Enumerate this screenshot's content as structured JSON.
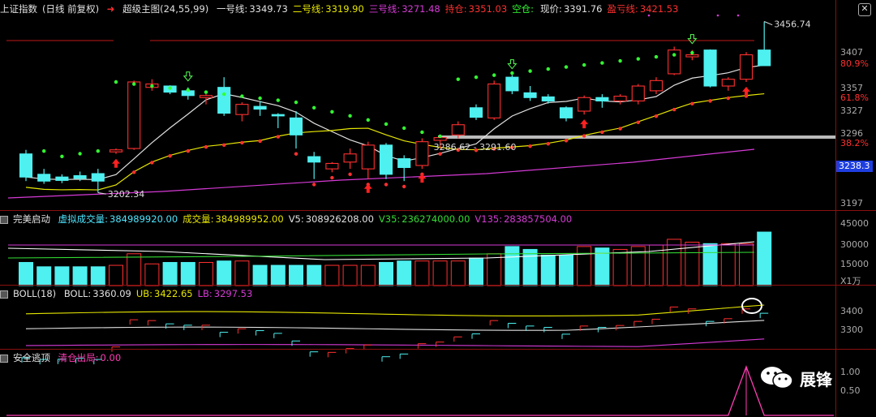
{
  "main": {
    "title": "上证指数",
    "period": "(日线 前复权)",
    "indicator_name": "超级主图",
    "indicator_params": "(24,55,99)",
    "items": [
      {
        "label": "一号线:",
        "value": "3349.73",
        "color": "#e0e0e0"
      },
      {
        "label": "二号线:",
        "value": "3319.90",
        "color": "#e6e600"
      },
      {
        "label": "三号线:",
        "value": "3271.48",
        "color": "#d63ad6"
      },
      {
        "label": "持仓:",
        "value": "3351.03",
        "color": "#ff3030"
      },
      {
        "label": "空仓:",
        "value": "",
        "color": "#33ff33"
      },
      {
        "label": "现价:",
        "value": "3391.76",
        "color": "#e0e0e0"
      },
      {
        "label": "盈亏线:",
        "value": "3421.53",
        "color": "#ff3030"
      }
    ],
    "high_label": "3456.74",
    "low_label": "3202.34",
    "range_label": "3286.62 - 3291.60",
    "y_labels": [
      "3407",
      "80.9%",
      "3357",
      "61.8%",
      "3327",
      "3296",
      "38.2%",
      "3197"
    ],
    "current_tag": "3238.3"
  },
  "volume": {
    "title": "完美启动",
    "items": [
      {
        "label": "虚拟成交量:",
        "value": "384989920.00",
        "color": "#4de6ff"
      },
      {
        "label": "成交量:",
        "value": "384989952.00",
        "color": "#e6e600"
      },
      {
        "label": "V5:",
        "value": "308926208.00",
        "color": "#e0e0e0"
      },
      {
        "label": "V35:",
        "value": "236274000.00",
        "color": "#33dd33"
      },
      {
        "label": "V135:",
        "value": "283857504.00",
        "color": "#d63ad6"
      }
    ],
    "y_labels": [
      "45000",
      "30000",
      "15000",
      "X1万"
    ]
  },
  "boll": {
    "title": "BOLL(18)",
    "items": [
      {
        "label": "BOLL:",
        "value": "3360.09",
        "color": "#e0e0e0"
      },
      {
        "label": "UB:",
        "value": "3422.65",
        "color": "#e6e600"
      },
      {
        "label": "LB:",
        "value": "3297.53",
        "color": "#d63ad6"
      }
    ],
    "y_labels": [
      "3400",
      "3300"
    ]
  },
  "safe": {
    "title": "安全逃顶",
    "items": [
      {
        "label": "清仓出局:",
        "value": "0.00",
        "color": "#ff3cb4"
      }
    ],
    "y_labels": [
      "1.00",
      "0.50"
    ]
  },
  "watermark": "展锋",
  "colors": {
    "up": "#ff3030",
    "down": "#4ef0f0",
    "ma_white": "#e0e0e0",
    "ma_yellow": "#e6e600",
    "ma_purple": "#d63ad6"
  },
  "chart_data": {
    "type": "candlestick",
    "price_range": [
      3190,
      3460
    ],
    "candles": [
      {
        "o": 3262,
        "h": 3268,
        "l": 3222,
        "c": 3228
      },
      {
        "o": 3232,
        "h": 3240,
        "l": 3218,
        "c": 3222
      },
      {
        "o": 3228,
        "h": 3232,
        "l": 3219,
        "c": 3223
      },
      {
        "o": 3230,
        "h": 3236,
        "l": 3222,
        "c": 3226
      },
      {
        "o": 3233,
        "h": 3240,
        "l": 3205,
        "c": 3222
      },
      {
        "o": 3265,
        "h": 3270,
        "l": 3262,
        "c": 3268
      },
      {
        "o": 3270,
        "h": 3370,
        "l": 3268,
        "c": 3368
      },
      {
        "o": 3360,
        "h": 3372,
        "l": 3355,
        "c": 3365
      },
      {
        "o": 3362,
        "h": 3363,
        "l": 3350,
        "c": 3353
      },
      {
        "o": 3355,
        "h": 3360,
        "l": 3342,
        "c": 3348
      },
      {
        "o": 3345,
        "h": 3350,
        "l": 3335,
        "c": 3348
      },
      {
        "o": 3360,
        "h": 3375,
        "l": 3318,
        "c": 3322
      },
      {
        "o": 3320,
        "h": 3338,
        "l": 3310,
        "c": 3335
      },
      {
        "o": 3332,
        "h": 3340,
        "l": 3318,
        "c": 3328
      },
      {
        "o": 3320,
        "h": 3322,
        "l": 3300,
        "c": 3318
      },
      {
        "o": 3315,
        "h": 3325,
        "l": 3270,
        "c": 3290
      },
      {
        "o": 3258,
        "h": 3265,
        "l": 3225,
        "c": 3250
      },
      {
        "o": 3240,
        "h": 3250,
        "l": 3235,
        "c": 3248
      },
      {
        "o": 3250,
        "h": 3270,
        "l": 3240,
        "c": 3262
      },
      {
        "o": 3240,
        "h": 3280,
        "l": 3225,
        "c": 3275
      },
      {
        "o": 3275,
        "h": 3278,
        "l": 3225,
        "c": 3232
      },
      {
        "o": 3255,
        "h": 3260,
        "l": 3222,
        "c": 3242
      },
      {
        "o": 3245,
        "h": 3285,
        "l": 3240,
        "c": 3280
      },
      {
        "o": 3282,
        "h": 3290,
        "l": 3270,
        "c": 3286
      },
      {
        "o": 3290,
        "h": 3310,
        "l": 3285,
        "c": 3305
      },
      {
        "o": 3330,
        "h": 3335,
        "l": 3312,
        "c": 3316
      },
      {
        "o": 3315,
        "h": 3370,
        "l": 3312,
        "c": 3365
      },
      {
        "o": 3375,
        "h": 3378,
        "l": 3350,
        "c": 3355
      },
      {
        "o": 3352,
        "h": 3362,
        "l": 3340,
        "c": 3345
      },
      {
        "o": 3346,
        "h": 3350,
        "l": 3336,
        "c": 3340
      },
      {
        "o": 3330,
        "h": 3332,
        "l": 3310,
        "c": 3315
      },
      {
        "o": 3325,
        "h": 3348,
        "l": 3320,
        "c": 3345
      },
      {
        "o": 3345,
        "h": 3350,
        "l": 3330,
        "c": 3340
      },
      {
        "o": 3340,
        "h": 3350,
        "l": 3335,
        "c": 3347
      },
      {
        "o": 3340,
        "h": 3365,
        "l": 3335,
        "c": 3362
      },
      {
        "o": 3355,
        "h": 3375,
        "l": 3350,
        "c": 3370
      },
      {
        "o": 3380,
        "h": 3420,
        "l": 3378,
        "c": 3415
      },
      {
        "o": 3405,
        "h": 3415,
        "l": 3400,
        "c": 3408
      },
      {
        "o": 3415,
        "h": 3416,
        "l": 3360,
        "c": 3362
      },
      {
        "o": 3362,
        "h": 3375,
        "l": 3355,
        "c": 3372
      },
      {
        "o": 3372,
        "h": 3412,
        "l": 3368,
        "c": 3408
      },
      {
        "o": 3415,
        "h": 3457,
        "l": 3392,
        "c": 3392
      }
    ],
    "volumes": [
      16,
      13,
      13,
      13,
      13,
      14,
      22,
      15,
      16,
      16,
      16,
      17,
      17,
      14,
      14,
      14,
      14,
      14,
      14,
      14,
      16,
      17,
      17,
      17,
      17,
      19,
      22,
      27,
      25,
      21,
      21,
      27,
      26,
      25,
      27,
      28,
      32,
      30,
      29,
      29,
      29,
      37
    ],
    "safe_escape": [
      0,
      0,
      0,
      0,
      0,
      0,
      0,
      0,
      0,
      0,
      0,
      0,
      0,
      0,
      0,
      0,
      0,
      0,
      0,
      0,
      0,
      0,
      0,
      0,
      0,
      0,
      0,
      0,
      0,
      0,
      0,
      0,
      0,
      0,
      0,
      0,
      0,
      0,
      0,
      0,
      1,
      0
    ]
  }
}
